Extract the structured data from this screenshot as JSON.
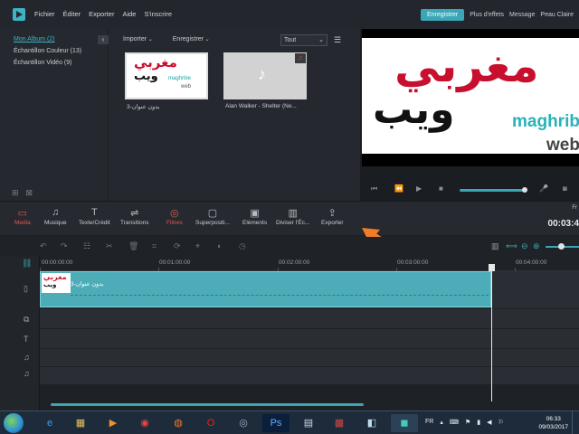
{
  "app": {
    "menu": [
      "Fichier",
      "Éditer",
      "Exporter",
      "Aide",
      "S'inscrire"
    ],
    "actions": {
      "save": "Enregistrer",
      "effects": "Plus d'effets",
      "message": "Message",
      "skin": "Peau Claire"
    }
  },
  "library": {
    "albums": [
      "Mon Album (2)",
      "Échantillon Couleur (13)",
      "Échantillon Vidéo (9)"
    ],
    "import_label": "Importer",
    "record_label": "Enregistrer",
    "filter_value": "Tout",
    "media": [
      {
        "caption": "بدون عنوان-3"
      },
      {
        "caption": "Alan Walker - Shelter (Ne..."
      }
    ]
  },
  "logo_text": {
    "line1": "مغربي",
    "line2": "ويب",
    "latin1": "maghribe",
    "latin2": "web"
  },
  "toolbar": {
    "tools": [
      "Media",
      "Musique",
      "Texte/Crédit",
      "Transitions",
      "Filtres",
      "Superpositi...",
      "Eléments",
      "Diviser l'Éc...",
      "Exporter"
    ],
    "fr_label": "Fr",
    "timecode": "00:03:4"
  },
  "timeline": {
    "ruler": [
      "00:00:00:00",
      "00:01:00:00",
      "00:02:00:00",
      "00:03:00:00",
      "00:04:00:00"
    ],
    "clip_label": "بدون عنوان-3"
  },
  "taskbar": {
    "lang": "FR",
    "time": "06:33",
    "date": "09/03/2017"
  },
  "colors": {
    "accent": "#3aa6b6",
    "active": "#e0574f",
    "arrow": "#f07d2a"
  }
}
